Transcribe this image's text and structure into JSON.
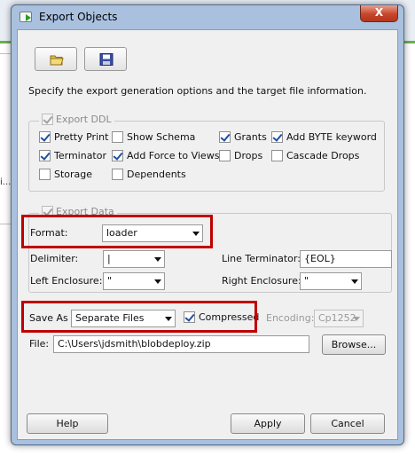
{
  "window": {
    "title": "Export Objects",
    "close_label": "X"
  },
  "toolbar": {
    "open_icon": "folder-open-icon",
    "save_icon": "floppy-save-icon"
  },
  "description": "Specify the export generation options and the target file information.",
  "export_ddl": {
    "label": "Export DDL",
    "checked": true,
    "options": [
      {
        "label": "Pretty Print",
        "checked": true
      },
      {
        "label": "Show Schema",
        "checked": false
      },
      {
        "label": "Grants",
        "checked": true
      },
      {
        "label": "Add BYTE keyword",
        "checked": true
      },
      {
        "label": "Terminator",
        "checked": true
      },
      {
        "label": "Add Force to Views",
        "checked": true
      },
      {
        "label": "Drops",
        "checked": false
      },
      {
        "label": "Cascade Drops",
        "checked": false
      },
      {
        "label": "Storage",
        "checked": false
      },
      {
        "label": "Dependents",
        "checked": false
      }
    ]
  },
  "export_data": {
    "label": "Export Data",
    "checked": true,
    "format_label": "Format:",
    "format_value": "loader",
    "delimiter_label": "Delimiter:",
    "delimiter_value": "|",
    "line_terminator_label": "Line Terminator:",
    "line_terminator_value": "{EOL}",
    "left_enclosure_label": "Left Enclosure:",
    "left_enclosure_value": "\"",
    "right_enclosure_label": "Right Enclosure:",
    "right_enclosure_value": "\""
  },
  "save": {
    "save_as_label": "Save As",
    "save_as_value": "Separate Files",
    "compressed_label": "Compressed",
    "compressed_checked": true,
    "encoding_label": "Encoding:",
    "encoding_value": "Cp1252",
    "file_label": "File:",
    "file_value": "C:\\Users\\jdsmith\\blobdeploy.zip",
    "browse_label": "Browse..."
  },
  "footer": {
    "help_label": "Help",
    "apply_label": "Apply",
    "cancel_label": "Cancel"
  },
  "colors": {
    "highlight": "#c00000",
    "window_frame": "#a9c1df",
    "panel": "#f0f0f0"
  }
}
